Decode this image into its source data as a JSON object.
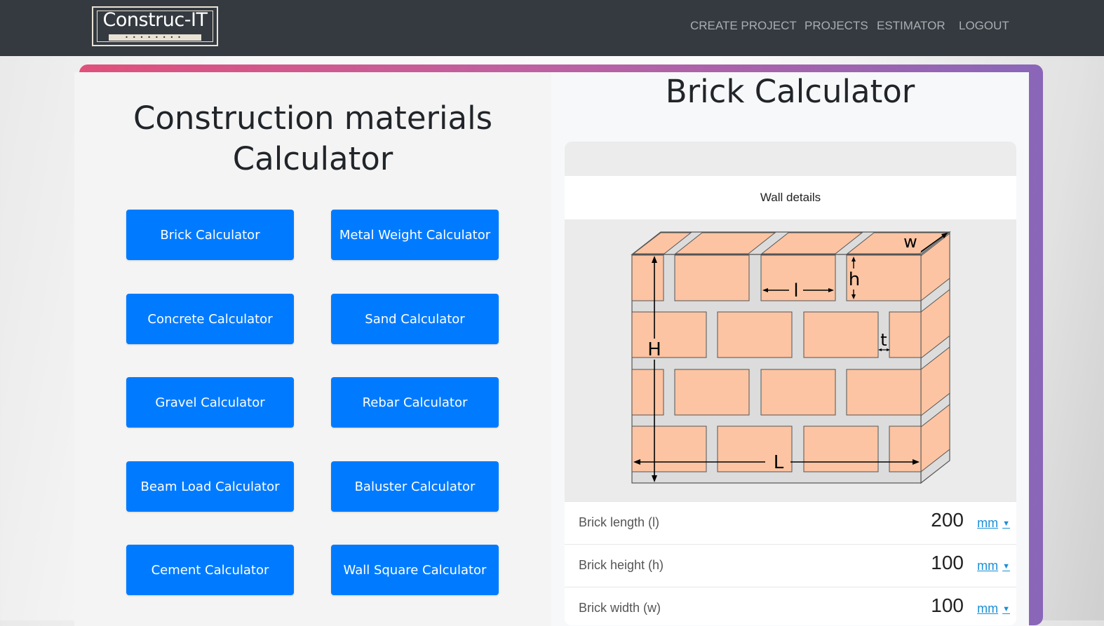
{
  "brand": {
    "logo_text": "Construc-IT",
    "logo_dots": "••••••••"
  },
  "nav": {
    "create_project": "CREATE PROJECT",
    "projects": "PROJECTS",
    "estimator": "ESTIMATOR",
    "logout": "LOGOUT"
  },
  "left": {
    "title_line1": "Construction materials",
    "title_line2": "Calculator",
    "buttons": [
      "Brick Calculator",
      "Metal Weight Calculator",
      "Concrete Calculator",
      "Sand Calculator",
      "Gravel Calculator",
      "Rebar Calculator",
      "Beam Load Calculator",
      "Baluster Calculator",
      "Cement Calculator",
      "Wall Square Calculator"
    ]
  },
  "right": {
    "title": "Brick Calculator",
    "section": "Wall details",
    "diagram_labels": {
      "w": "w",
      "h": "h",
      "l": "l",
      "t": "t",
      "H": "H",
      "L": "L"
    },
    "fields": [
      {
        "label": "Brick length (l)",
        "value": "200",
        "unit": "mm"
      },
      {
        "label": "Brick height (h)",
        "value": "100",
        "unit": "mm"
      },
      {
        "label": "Brick width (w)",
        "value": "100",
        "unit": "mm"
      }
    ]
  },
  "colors": {
    "navbar": "#343a40",
    "button": "#007bff",
    "brick": "#fcc4a2",
    "mortar": "#dcdcdc",
    "unit_link": "#1a8fd6"
  }
}
